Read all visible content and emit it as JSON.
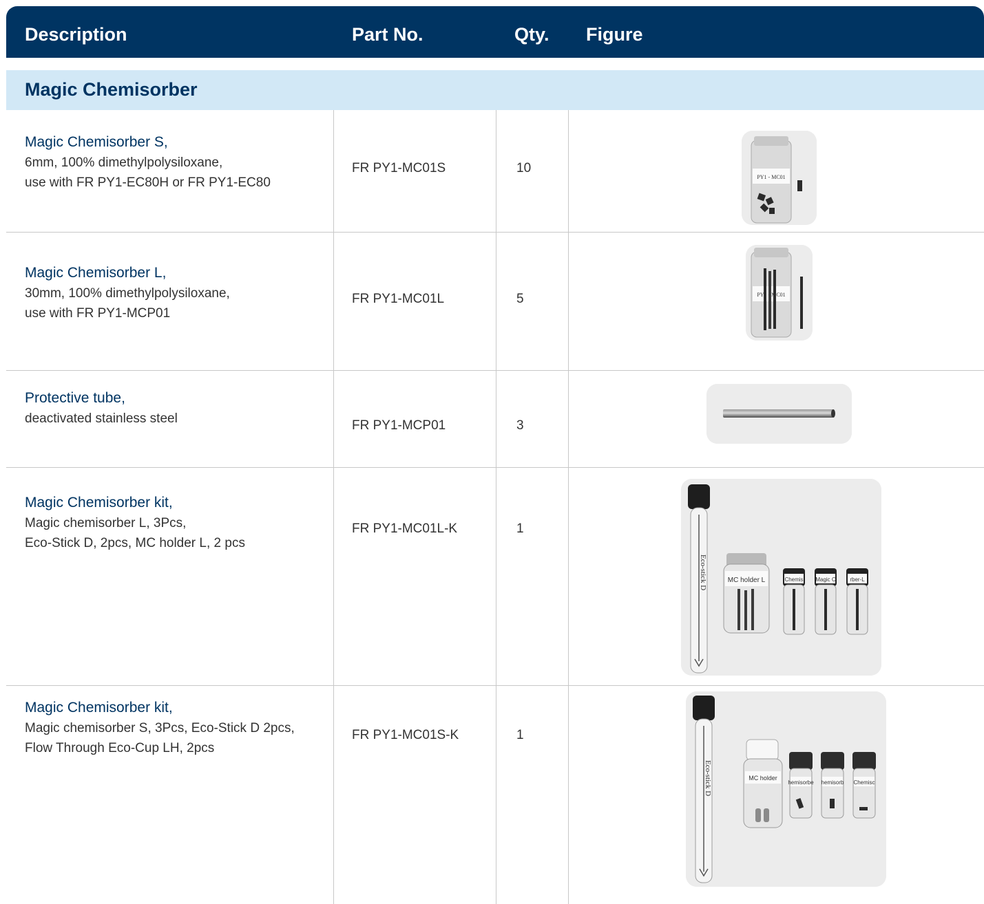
{
  "header": {
    "description": "Description",
    "part_no": "Part No.",
    "qty": "Qty.",
    "figure": "Figure"
  },
  "section": {
    "title": "Magic Chemisorber"
  },
  "rows": [
    {
      "title": "Magic Chemisorber S,",
      "lines": [
        "6mm, 100% dimethylpolysiloxane,",
        "use with FR PY1-EC80H or FR PY1-EC80"
      ],
      "part_no": "FR PY1-MC01S",
      "qty": "10",
      "figure_labels": [
        "PY1 - MC01"
      ]
    },
    {
      "title": "Magic Chemisorber L,",
      "lines": [
        "30mm, 100% dimethylpolysiloxane,",
        "use with FR PY1-MCP01"
      ],
      "part_no": "FR PY1-MC01L",
      "qty": "5",
      "figure_labels": [
        "PY1 - MC01"
      ]
    },
    {
      "title": "Protective tube,",
      "lines": [
        "deactivated stainless steel"
      ],
      "part_no": "FR PY1-MCP01",
      "qty": "3",
      "figure_labels": []
    },
    {
      "title": "Magic Chemisorber kit,",
      "lines": [
        "Magic chemisorber L, 3Pcs,",
        "Eco-Stick D, 2pcs, MC holder L, 2 pcs"
      ],
      "part_no": "FR PY1-MC01L-K",
      "qty": "1",
      "figure_labels": [
        "Eco-stick D",
        "MC holder L",
        "Chemis",
        "Magic C",
        "rber-L"
      ]
    },
    {
      "title": "Magic Chemisorber kit,",
      "lines": [
        "Magic chemisorber S, 3Pcs, Eco-Stick D 2pcs,",
        "Flow Through Eco-Cup LH, 2pcs"
      ],
      "part_no": "FR PY1-MC01S-K",
      "qty": "1",
      "figure_labels": [
        "Eco-stick D",
        "MC holder",
        "hemisorbe",
        "hemisorb",
        "Chemisc"
      ]
    }
  ],
  "colors": {
    "header_bg": "#003462",
    "section_bg": "#d2e8f6",
    "title_text": "#003462",
    "body_text": "#333333",
    "rule": "#c8c8c8"
  }
}
